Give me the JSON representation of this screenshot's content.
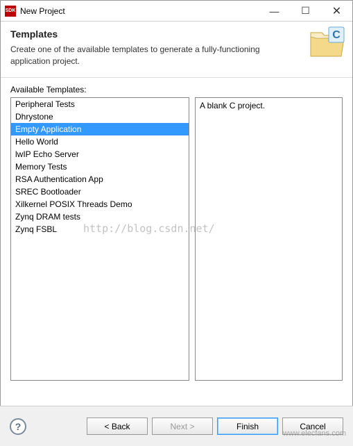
{
  "window": {
    "icon_label": "SDK",
    "title": "New Project",
    "minimize": "—",
    "maximize": "☐",
    "close": "✕"
  },
  "header": {
    "title": "Templates",
    "description": "Create one of the available templates to generate a fully-functioning application project."
  },
  "templates": {
    "label": "Available Templates:",
    "items": [
      "Peripheral Tests",
      "Dhrystone",
      "Empty Application",
      "Hello World",
      "lwIP Echo Server",
      "Memory Tests",
      "RSA Authentication App",
      "SREC Bootloader",
      "Xilkernel POSIX Threads Demo",
      "Zynq DRAM tests",
      "Zynq FSBL"
    ],
    "selected_index": 2,
    "description": "A blank C project."
  },
  "buttons": {
    "help": "?",
    "back": "< Back",
    "next": "Next >",
    "finish": "Finish",
    "cancel": "Cancel"
  },
  "watermark": {
    "url": "http://blog.csdn.net/",
    "source": "www.elecfans.com"
  }
}
